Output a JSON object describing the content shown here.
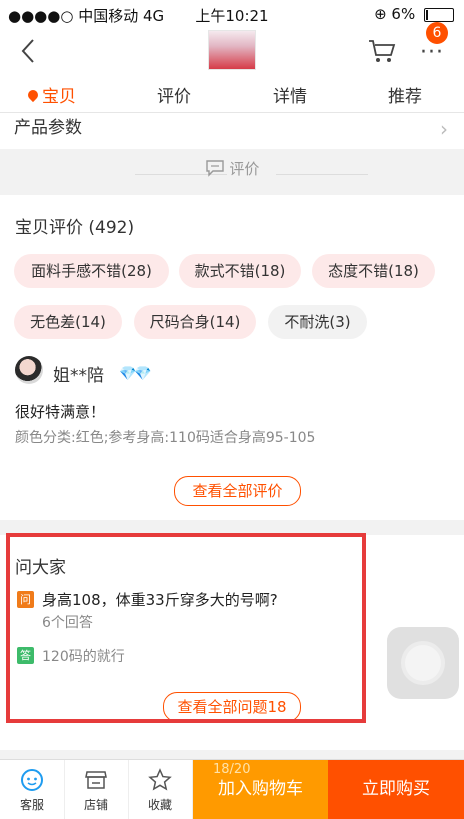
{
  "status_bar": {
    "carrier": "●●●●○ 中国移动  4G",
    "time": "上午10:21",
    "battery": "6%",
    "rotation_lock": "⊕"
  },
  "nav": {
    "back_icon": "chevron-left-icon",
    "cart_icon": "cart-icon",
    "more_icon": "more-icon",
    "more_glyph": "···",
    "badge": "6"
  },
  "tabs": [
    {
      "label": "宝贝",
      "active": true
    },
    {
      "label": "评价",
      "active": false
    },
    {
      "label": "详情",
      "active": false
    },
    {
      "label": "推荐",
      "active": false
    }
  ],
  "params": {
    "title": "产品参数",
    "chevron": "›"
  },
  "divider": {
    "label": "评价"
  },
  "reviews": {
    "title": "宝贝评价 (492)",
    "tags": [
      "面料手感不错(28)",
      "款式不错(18)",
      "态度不错(18)",
      "无色差(14)",
      "尺码合身(14)",
      "不耐洗(3)"
    ],
    "first": {
      "user": "姐**陪",
      "gems": "💎💎",
      "comment": "很好特满意！",
      "spec": "颜色分类:红色;参考身高:110码适合身高95-105"
    },
    "view_all": "查看全部评价"
  },
  "qa": {
    "title": "问大家",
    "q_tag": "问",
    "question": "身高108，体重33斤穿多大的号啊?",
    "answer_count": "6个回答",
    "a_tag": "答",
    "answer": "120码的就行",
    "view_all": "查看全部问题18"
  },
  "bottom": {
    "service": "客服",
    "shop": "店铺",
    "favorite": "收藏",
    "pager": "18/20",
    "add_cart": "加入购物车",
    "buy_now": "立即购买"
  },
  "colors": {
    "accent": "#ff5000",
    "cart_btn": "#ff9a00",
    "highlight": "#e63b3b",
    "tag_bg": "#fde9e9",
    "qa_q": "#f07b1a",
    "qa_a": "#3dbb6a"
  }
}
